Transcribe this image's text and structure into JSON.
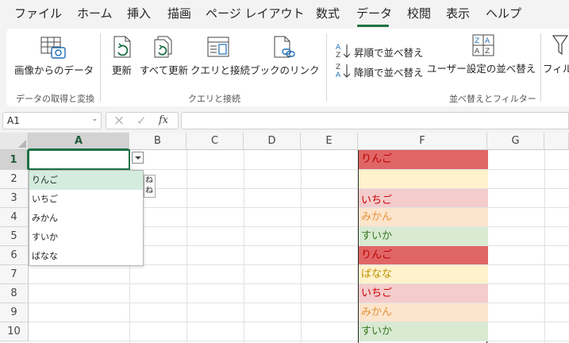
{
  "menu": {
    "tabs": [
      "ファイル",
      "ホーム",
      "挿入",
      "描画",
      "ページ レイアウト",
      "数式",
      "データ",
      "校閲",
      "表示",
      "ヘルプ"
    ],
    "active_tab": "データ"
  },
  "ribbon": {
    "get_data_from_image": "画像からのデータ",
    "group_get_transform": "データの取得と変換",
    "refresh": "更新",
    "refresh_all": "すべて更新",
    "queries_connections": "クエリと接続",
    "workbook_links": "ブックのリンク",
    "group_queries": "クエリと接続",
    "sort_asc": "昇順で並べ替え",
    "sort_desc": "降順で並べ替え",
    "custom_sort": "ユーザー設定の並べ替え",
    "filter": "フィル",
    "group_sort_filter": "並べ替えとフィルター"
  },
  "formula_bar": {
    "name_box": "A1",
    "fx": "fx",
    "cancel": "×",
    "confirm": "✓",
    "value": ""
  },
  "grid": {
    "columns": [
      "A",
      "B",
      "C",
      "D",
      "E",
      "F",
      "G"
    ],
    "rows": [
      "1",
      "2",
      "3",
      "4",
      "5",
      "6",
      "7",
      "8",
      "9",
      "10"
    ],
    "column_f": [
      {
        "text": "りんご",
        "bg": "#e06666",
        "color": "#c00000"
      },
      {
        "text": "",
        "bg": "#fff2cc",
        "color": "#bf9000"
      },
      {
        "text": "いちご",
        "bg": "#f4cccc",
        "color": "#cc0000"
      },
      {
        "text": "みかん",
        "bg": "#fce5cd",
        "color": "#e69138"
      },
      {
        "text": "すいか",
        "bg": "#d9ead3",
        "color": "#38761d"
      },
      {
        "text": "りんご",
        "bg": "#e06666",
        "color": "#c00000"
      },
      {
        "text": "ばなな",
        "bg": "#fff2cc",
        "color": "#bf9000"
      },
      {
        "text": "いちご",
        "bg": "#f4cccc",
        "color": "#cc0000"
      },
      {
        "text": "みかん",
        "bg": "#fce5cd",
        "color": "#e69138"
      },
      {
        "text": "すいか",
        "bg": "#d9ead3",
        "color": "#38761d"
      }
    ],
    "tip_text": [
      "ね",
      "ね"
    ]
  },
  "dropdown": {
    "items": [
      "りんご",
      "いちご",
      "みかん",
      "すいか",
      "ばなな"
    ],
    "selected_index": 0
  },
  "colors": {
    "accent": "#1e7145",
    "selection_highlight": "#d3ecde"
  }
}
